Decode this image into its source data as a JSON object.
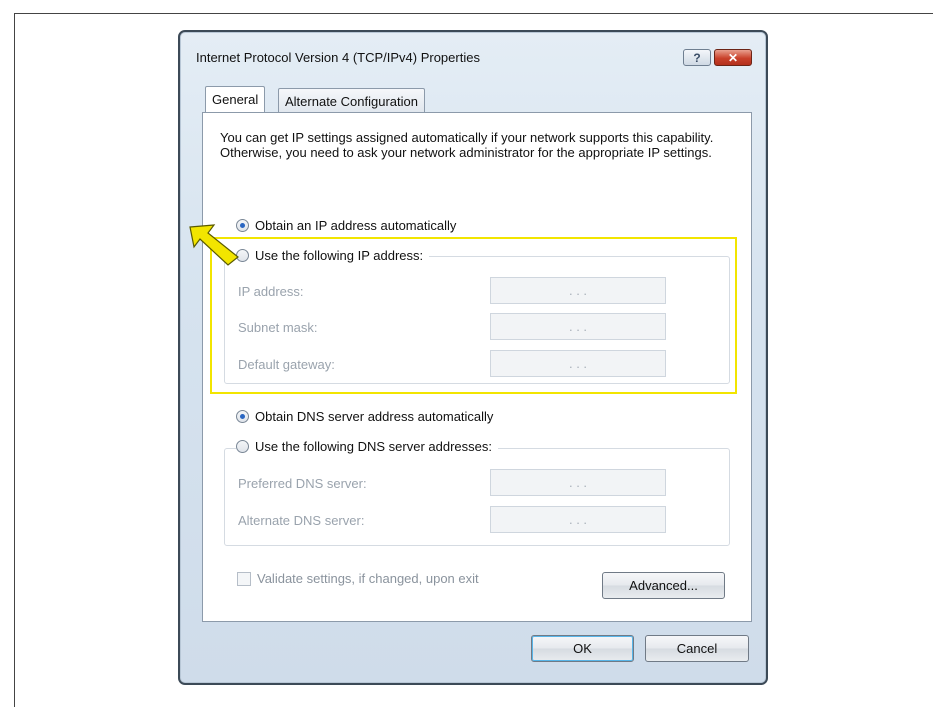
{
  "dialog": {
    "title": "Internet Protocol Version 4 (TCP/IPv4) Properties",
    "help_glyph": "?",
    "close_glyph": "✕"
  },
  "tabs": [
    {
      "label": "General",
      "selected": true
    },
    {
      "label": "Alternate Configuration",
      "selected": false
    }
  ],
  "intro_text": "You can get IP settings assigned automatically if your network supports this capability. Otherwise, you need to ask your network administrator for the appropriate IP settings.",
  "ip_section": {
    "auto_label": "Obtain an IP address automatically",
    "manual_label": "Use the following IP address:",
    "selected": "auto",
    "fields": [
      {
        "label": "IP address:",
        "value": ".   .   ."
      },
      {
        "label": "Subnet mask:",
        "value": ".   .   ."
      },
      {
        "label": "Default gateway:",
        "value": ".   .   ."
      }
    ]
  },
  "dns_section": {
    "auto_label": "Obtain DNS server address automatically",
    "manual_label": "Use the following DNS server addresses:",
    "selected": "auto",
    "fields": [
      {
        "label": "Preferred DNS server:",
        "value": ".   .   ."
      },
      {
        "label": "Alternate DNS server:",
        "value": ".   .   ."
      }
    ]
  },
  "validate_label": "Validate settings, if changed, upon exit",
  "buttons": {
    "advanced": "Advanced...",
    "ok": "OK",
    "cancel": "Cancel"
  },
  "colors": {
    "highlight": "#f2e500",
    "arrow": "#f2e500",
    "accent": "#2a66c2"
  }
}
